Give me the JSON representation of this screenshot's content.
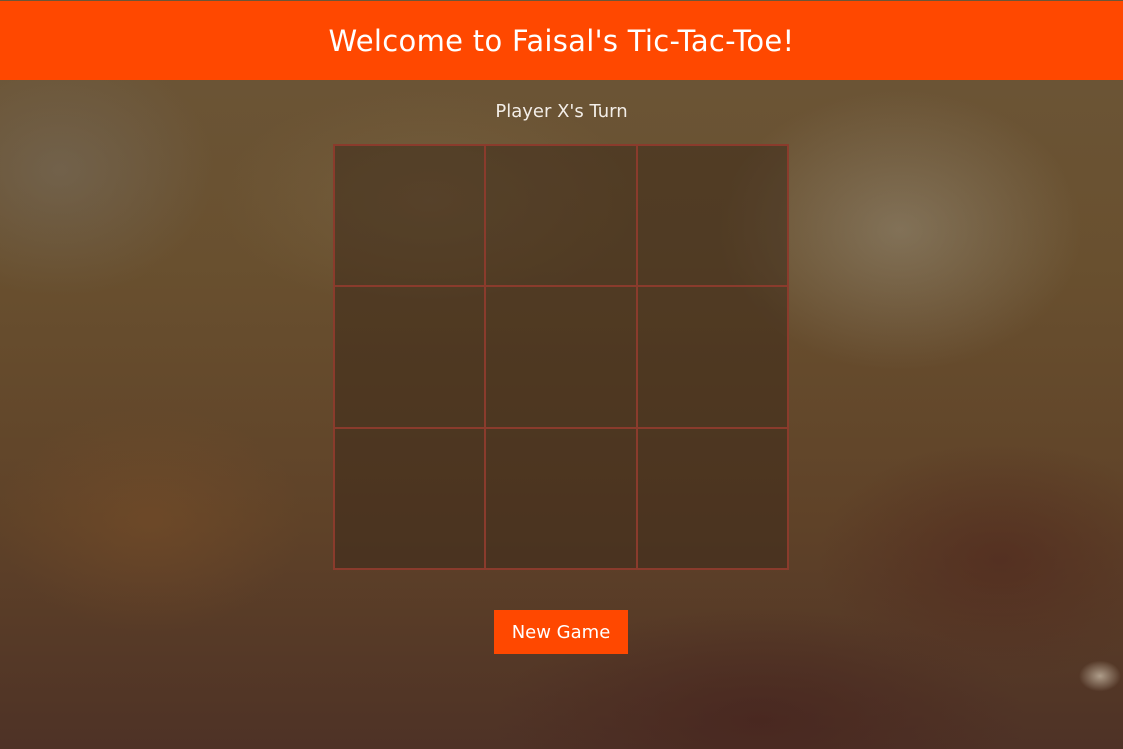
{
  "header": {
    "title": "Welcome to Faisal's Tic-Tac-Toe!"
  },
  "status": {
    "turn_text": "Player X's Turn"
  },
  "board": {
    "cells": [
      "",
      "",
      "",
      "",
      "",
      "",
      "",
      "",
      ""
    ]
  },
  "controls": {
    "new_game_label": "New Game"
  },
  "colors": {
    "accent": "#ff4800",
    "grid_line": "#8a3b2c"
  }
}
